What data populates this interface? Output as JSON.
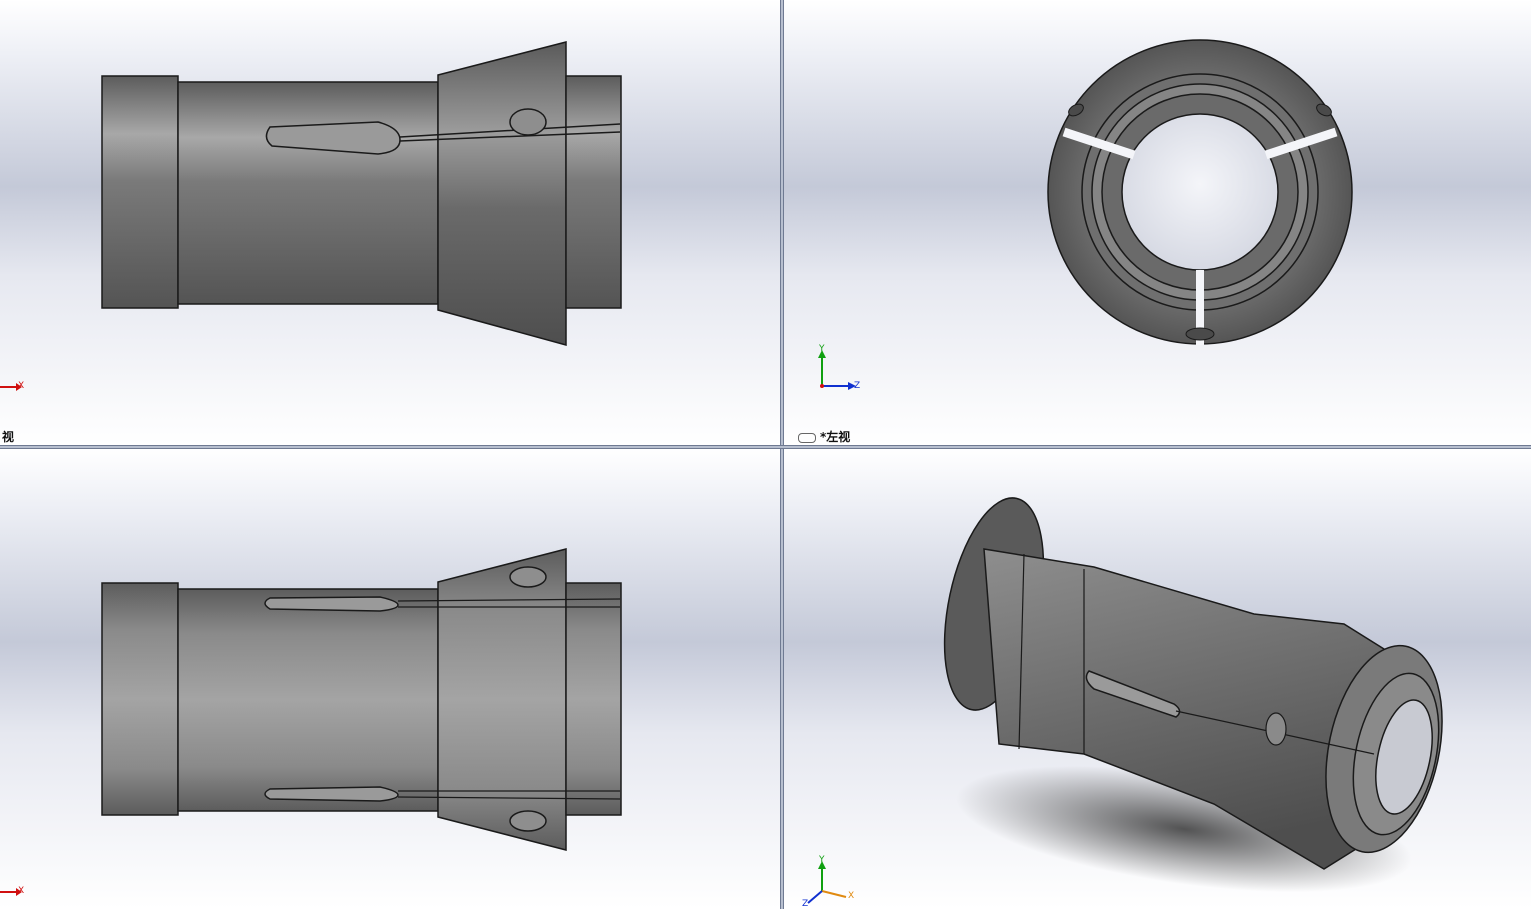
{
  "viewports": {
    "top_left": {
      "label": "视"
    },
    "top_right": {
      "label": "*左视"
    },
    "bottom_left": {
      "label": ""
    },
    "bottom_right": {
      "label": ""
    }
  },
  "triad": {
    "x": "X",
    "y": "Y",
    "z": "Z"
  },
  "colors": {
    "x_axis": "#d01010",
    "y_axis": "#10a010",
    "z_axis": "#1030d0",
    "part": "#6c6c6c",
    "edge": "#1a1a1a"
  },
  "icons": [
    "link-icon",
    "axis-triad-icon"
  ]
}
